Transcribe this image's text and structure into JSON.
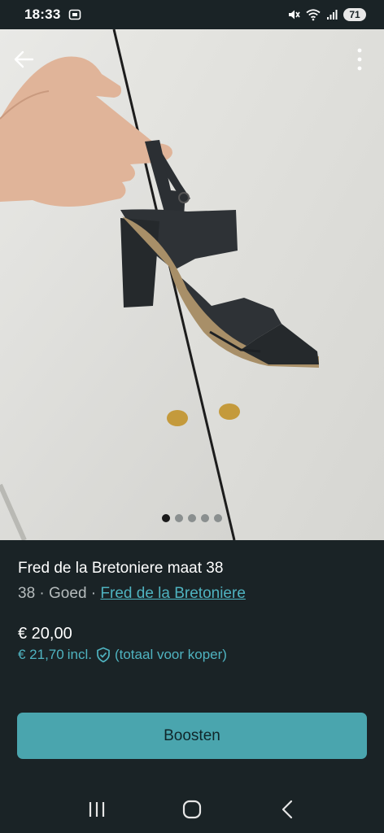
{
  "status_bar": {
    "time": "18:33",
    "battery": "71",
    "icons": [
      "screenshot-icon",
      "mute-icon",
      "wifi-icon",
      "signal-icon"
    ]
  },
  "photo": {
    "subject": "black-high-heel-sandal-photo",
    "page_count": 5,
    "active_index": 0
  },
  "listing": {
    "title": "Fred de la Bretoniere maat 38",
    "size": "38",
    "separator": " · ",
    "condition": "Goed",
    "brand": "Fred de la Bretoniere",
    "price": "€ 20,00",
    "price_incl": "€ 21,70",
    "incl_label": "incl.",
    "incl_note": "(totaal voor koper)"
  },
  "actions": {
    "boost_label": "Boosten"
  },
  "colors": {
    "background": "#1a2326",
    "accent": "#4fb3c0",
    "button": "#4aa5ae"
  }
}
